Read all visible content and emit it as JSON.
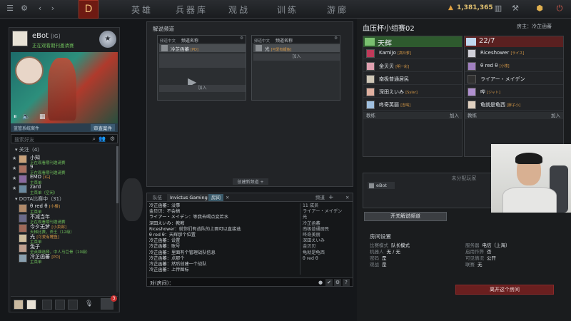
{
  "topbar": {
    "nav": [
      "英雄",
      "兵器库",
      "观战",
      "训练",
      "游廊"
    ],
    "gold": "1,381,365",
    "logo": "D"
  },
  "profile": {
    "name": "eBot",
    "tag": "[IG]",
    "status": "正在观看期刊邀请赛"
  },
  "showcase": {
    "status_label": "蓝管系统案件",
    "review_button": "审查案件"
  },
  "search": {
    "placeholder": "搜索好友"
  },
  "friends": {
    "group1_label": "关注（4）",
    "group1": [
      {
        "name": "小知",
        "tag": "",
        "status": "正在观看期刊邀请赛"
      },
      {
        "name": "9",
        "tag": "",
        "status": "正在观看期刊邀请赛"
      },
      {
        "name": "EMO",
        "tag": "[IG]",
        "status": "主菜单"
      },
      {
        "name": "zard",
        "tag": "",
        "status": "主菜单（空闲）"
      }
    ],
    "group2_label": "DOTA比赛中（31）",
    "group2": [
      {
        "name": "θ red θ",
        "tag": "[小楼]",
        "status": "主菜单"
      },
      {
        "name": "不减当年",
        "tag": "",
        "status": "正在观看期刊邀请赛"
      },
      {
        "name": "今夕无梦",
        "tag": "[小卖部]",
        "status": "天梯比赛，斧王（12级）"
      },
      {
        "name": "光",
        "tag": "[可爱有鲤鱼]",
        "status": "主菜单"
      },
      {
        "name": "兔子",
        "tag": "",
        "status": "全英雄选择，中人马巨骨（10级）"
      },
      {
        "name": "冷芷函蕃",
        "tag": "[PD]",
        "status": "主菜单"
      }
    ]
  },
  "party": {
    "badge": "3"
  },
  "casters": {
    "title": "解说频道",
    "channel1": {
      "col1": "频道中文",
      "col2": "频道名称",
      "member": "冷芷函蕃",
      "member_tag": "[PD]",
      "join": "加入"
    },
    "channel2": {
      "col1": "频道中文",
      "col2": "频道名称",
      "member": "光",
      "member_tag": "[可爱有鲤鱼]",
      "join": "加入"
    },
    "new_channel": "创建新频道 +"
  },
  "chat": {
    "tabs": [
      "队伍",
      "Invictus Gaming",
      "房间"
    ],
    "channel_label": "频道",
    "lines": [
      {
        "who": "冷芷函蕃：",
        "text": "没事"
      },
      {
        "who": "金贝贝：",
        "text": "不会搞"
      },
      {
        "who": "ライアー・メイデン：",
        "text": "等我去喝点変若水"
      },
      {
        "who": "深田えいみ：",
        "text": "教教"
      },
      {
        "who": "Riceshower：",
        "text": "就你们有战队的上面可以直接选"
      },
      {
        "who": "θ red θ：",
        "text": "天辉那个位置"
      },
      {
        "who": "冷芷函蕃：",
        "text": "设置"
      },
      {
        "who": "冷芷函蕃：",
        "text": "账号"
      },
      {
        "who": "冷芷函蕃：",
        "text": "里面有个管理战队信息"
      },
      {
        "who": "冷芷函蕃：",
        "text": "点那个"
      },
      {
        "who": "冷芷函蕃：",
        "text": "然后创建一个战队"
      },
      {
        "who": "冷芷函蕃：",
        "text": "上传图标"
      },
      {
        "who": "冷芷函蕃：",
        "text": "你们就能排战队了"
      }
    ],
    "members": [
      "11 成员",
      "ライアー・メイデン",
      "光",
      "冷芷函蕃",
      "南极普通居民",
      "咚奇美丽",
      "深田えいみ",
      "金贝贝",
      "龟就是龟西",
      "θ red θ"
    ],
    "input_label": "对(房间)："
  },
  "lobby": {
    "title": "血压杯小组赛02",
    "host": "房主：冷芷函蕃",
    "radiant": {
      "name": "天辉",
      "players": [
        {
          "name": "KamiJo",
          "tag": "[高玲爹]"
        },
        {
          "name": "金贝贝",
          "tag": "[明一彩]"
        },
        {
          "name": "南极普通居民",
          "tag": ""
        },
        {
          "name": "深田えいみ",
          "tag": "[Sylar]"
        },
        {
          "name": "咚奇英丽",
          "tag": "[吉喝]"
        }
      ],
      "coach": "教练",
      "join": "加入"
    },
    "dire": {
      "name": "22/7",
      "players": [
        {
          "name": "Riceshower",
          "tag": "[ライス]"
        },
        {
          "name": "θ red θ",
          "tag": "[小楼]"
        },
        {
          "name": "ライアー・メイデン",
          "tag": ""
        },
        {
          "name": "哔",
          "tag": "[ジャト]"
        },
        {
          "name": "龟就是龟西",
          "tag": "[胖子小]"
        }
      ],
      "coach": "教练",
      "join": "加入"
    },
    "unassigned_title": "未分配玩家",
    "unassigned_player": "eBot",
    "open_casters_button": "开关解说频道",
    "settings_title": "房间设置",
    "settings": {
      "mode_label": "比赛模式",
      "mode": "队长模式",
      "bots_label": "机器人",
      "bots": "无 / 无",
      "password_label": "密码",
      "password": "是",
      "league_label": "观战",
      "league": "是",
      "server_label": "服务器",
      "server": "电信（上海）",
      "cheats_label": "启用作弊",
      "cheats": "否",
      "visibility_label": "可见情况",
      "visibility": "公开",
      "ticket_label": "联赛",
      "ticket": "无"
    },
    "leave_button": "离开这个房间"
  }
}
